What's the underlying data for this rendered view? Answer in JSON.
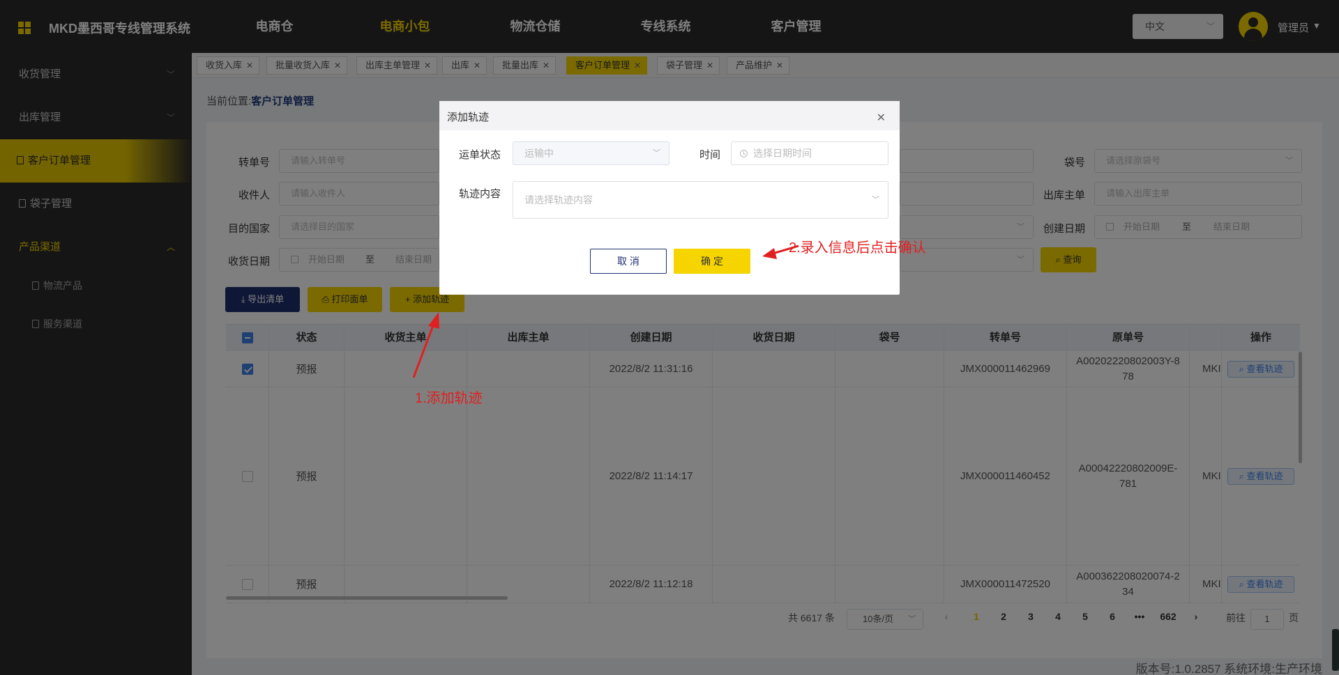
{
  "app": {
    "title": "MKD墨西哥专线管理系统",
    "nav": [
      "电商仓",
      "电商小包",
      "物流仓储",
      "专线系统",
      "客户管理"
    ],
    "active_nav": "电商小包",
    "language": "中文",
    "user": "管理员"
  },
  "sidebar": {
    "items": [
      {
        "label": "收货管理"
      },
      {
        "label": "出库管理"
      },
      {
        "label": "客户订单管理"
      },
      {
        "label": "袋子管理"
      },
      {
        "label": "产品渠道"
      }
    ],
    "sub_items": [
      "物流产品",
      "服务渠道"
    ]
  },
  "tabs": [
    "收货入库",
    "批量收货入库",
    "出库主单管理",
    "出库",
    "批量出库",
    "客户订单管理",
    "袋子管理",
    "产品维护"
  ],
  "active_tab": "客户订单管理",
  "breadcrumb": {
    "prefix": "当前位置:",
    "current": "客户订单管理"
  },
  "filters": {
    "labels": {
      "waybill": "转单号",
      "receiver": "收件人",
      "country": "目的国家",
      "receive_date": "收货日期",
      "bag_no": "袋号",
      "outbound": "出库主单",
      "created": "创建日期"
    },
    "placeholders": {
      "waybill": "请输入转单号",
      "receiver": "请输入收件人",
      "country": "请选择目的国家",
      "bag_no": "请选择原袋号",
      "outbound": "请输入出库主单",
      "start": "开始日期",
      "end": "结束日期",
      "range_sep": "至"
    },
    "query_button": "查询"
  },
  "toolbar": {
    "export": "导出清单",
    "print": "打印面单",
    "add_track": "添加轨迹"
  },
  "table": {
    "columns": [
      "状态",
      "收货主单",
      "出库主单",
      "创建日期",
      "收货日期",
      "袋号",
      "转单号",
      "原单号",
      "操作"
    ],
    "action_label": "查看轨迹",
    "rows": [
      {
        "status": "预报",
        "created": "2022/8/2 11:31:16",
        "waybill": "JMX000011462969",
        "origin_l1": "A00202220802003Y-8",
        "origin_l2": "78",
        "partial": "MKI",
        "checked": true
      },
      {
        "status": "预报",
        "created": "2022/8/2 11:14:17",
        "waybill": "JMX000011460452",
        "origin_l1": "A00042220802009E-",
        "origin_l2": "781",
        "partial": "MKI",
        "checked": false
      },
      {
        "status": "预报",
        "created": "2022/8/2 11:12:18",
        "waybill": "JMX000011472520",
        "origin_l1": "A000362208020074-2",
        "origin_l2": "34",
        "partial": "MKI",
        "checked": false
      }
    ]
  },
  "pagination": {
    "total": "共 6617 条",
    "page_size": "10条/页",
    "pages": [
      "1",
      "2",
      "3",
      "4",
      "5",
      "6",
      "•••",
      "662"
    ],
    "current": "1",
    "goto_label": "前往",
    "goto_value": "1",
    "page_unit": "页"
  },
  "footer": "版本号:1.0.2857 系统环境:生产环境",
  "modal": {
    "title": "添加轨迹",
    "status_label": "运单状态",
    "status_value": "运输中",
    "time_label": "时间",
    "time_placeholder": "选择日期时间",
    "content_label": "轨迹内容",
    "content_placeholder": "请选择轨迹内容",
    "cancel": "取 消",
    "confirm": "确 定"
  },
  "annotations": {
    "step1": "1.添加轨迹",
    "step2": "2.录入信息后点击确认"
  },
  "colors": {
    "accent": "#f5d400",
    "navy": "#1f2f6e",
    "annotation": "#e02020",
    "sidebar_bg": "#2b2b2b"
  }
}
